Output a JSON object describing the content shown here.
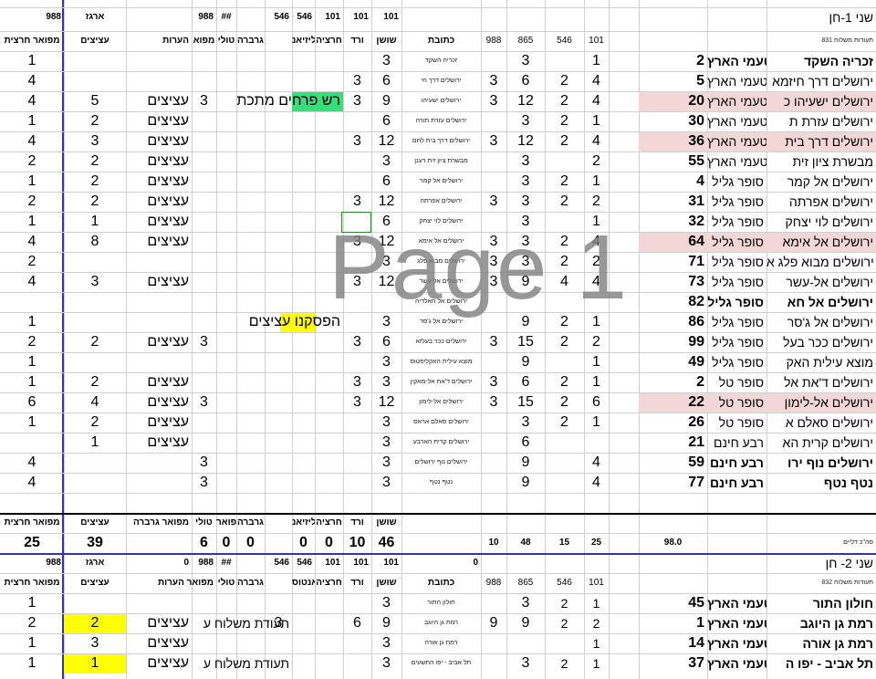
{
  "watermark": "Page 1",
  "section1": {
    "header_row1": {
      "c_988": "988",
      "c_argaz": "ארגז",
      "c_988b": "988",
      "c_hash": "##",
      "c_546a": "546",
      "c_546b": "546",
      "c_101a": "101",
      "c_101b": "101",
      "c_101c": "101"
    },
    "header_row2": {
      "mifoar": "מפואר חרצית",
      "atzitzim": "עציצים",
      "heorot": "הערות",
      "mefoar_t": "מפוא",
      "tulip": "טולי",
      "gerbera": "גרברה",
      "lisianthus": "ליזיאנ",
      "hartzit": "חרציה",
      "vered": "ורד",
      "shoshan": "שושן",
      "ktovet": "כתובת",
      "n988": "988",
      "n865": "865",
      "n546": "546",
      "n101": "101",
      "teudat": "תעודות משלוח 831"
    },
    "title": "שני 1-חן",
    "rows": [
      {
        "mifoar": "1",
        "atzitzim": "",
        "heorot": "",
        "mefoar": "",
        "shoshan": "3",
        "vered": "",
        "hartzit": "",
        "lisianthus": "",
        "ktovet": "זכריה השקד",
        "n988": "",
        "n865": "3",
        "n546": "",
        "n101": "1",
        "num": "2",
        "store": "מטעמי הארץ",
        "city": "זכריה השקד",
        "pink": false,
        "boldname": true
      },
      {
        "mifoar": "4",
        "atzitzim": "",
        "heorot": "",
        "mefoar": "",
        "shoshan": "6",
        "vered": "3",
        "hartzit": "",
        "lisianthus": "",
        "ktovet": "ירושלים דרך חי",
        "n988": "3",
        "n865": "6",
        "n546": "2",
        "n101": "4",
        "num": "5",
        "store": "מטעמי הארץ",
        "city": "ירושלים דרך חיזמא",
        "pink": false,
        "boldname": false
      },
      {
        "mifoar": "4",
        "atzitzim": "5",
        "heorot": "עציצים",
        "mefoar": "3",
        "shoshan": "9",
        "vered": "3",
        "hartzit": "",
        "lisianthus": "רש פרחים מתכת",
        "ktovet": "ירושלים ישעיהו",
        "n988": "3",
        "n865": "12",
        "n546": "2",
        "n101": "4",
        "num": "20",
        "store": "מטעמי הארץ",
        "city": "ירושלים ישעיהו כ",
        "pink": true,
        "boldname": false
      },
      {
        "mifoar": "1",
        "atzitzim": "2",
        "heorot": "עציצים",
        "mefoar": "",
        "shoshan": "6",
        "vered": "",
        "hartzit": "",
        "lisianthus": "",
        "ktovet": "ירושלים עזרת תורה",
        "n988": "",
        "n865": "3",
        "n546": "2",
        "n101": "1",
        "num": "30",
        "store": "מטעמי הארץ",
        "city": "ירושלים עזרת ת",
        "pink": false,
        "boldname": false
      },
      {
        "mifoar": "4",
        "atzitzim": "3",
        "heorot": "עציצים",
        "mefoar": "",
        "shoshan": "12",
        "vered": "3",
        "hartzit": "",
        "lisianthus": "",
        "ktovet": "ירושלים דרך בית לחם",
        "n988": "3",
        "n865": "12",
        "n546": "2",
        "n101": "4",
        "num": "36",
        "store": "מטעמי הארץ",
        "city": "ירושלים דרך בית",
        "pink": true,
        "boldname": false
      },
      {
        "mifoar": "2",
        "atzitzim": "2",
        "heorot": "עציצים",
        "mefoar": "",
        "shoshan": "3",
        "vered": "",
        "hartzit": "",
        "lisianthus": "",
        "ktovet": "מבשרת ציון זית רענן",
        "n988": "",
        "n865": "3",
        "n546": "",
        "n101": "2",
        "num": "55",
        "store": "מטעמי הארץ",
        "city": "מבשרת ציון זית",
        "pink": false,
        "boldname": false
      },
      {
        "mifoar": "1",
        "atzitzim": "2",
        "heorot": "עציצים",
        "mefoar": "",
        "shoshan": "6",
        "vered": "",
        "hartzit": "",
        "lisianthus": "",
        "ktovet": "ירושלים אל קמר",
        "n988": "",
        "n865": "3",
        "n546": "2",
        "n101": "1",
        "num": "4",
        "store": "סופר גליל",
        "city": "ירושלים אל קמר",
        "pink": false,
        "boldname": false
      },
      {
        "mifoar": "2",
        "atzitzim": "2",
        "heorot": "עציצים",
        "mefoar": "",
        "shoshan": "12",
        "vered": "3",
        "hartzit": "",
        "lisianthus": "",
        "ktovet": "ירושלים אפרתה",
        "n988": "3",
        "n865": "3",
        "n546": "2",
        "n101": "2",
        "num": "31",
        "store": "סופר גליל",
        "city": "ירושלים אפרתה",
        "pink": false,
        "boldname": false
      },
      {
        "mifoar": "1",
        "atzitzim": "1",
        "heorot": "עציצים",
        "mefoar": "",
        "shoshan": "6",
        "vered": "",
        "hartzit": "",
        "lisianthus": "",
        "ktovet": "ירושלים לוי יצחק",
        "n988": "",
        "n865": "3",
        "n546": "",
        "n101": "1",
        "num": "32",
        "store": "סופר גליל",
        "city": "ירושלים לוי יצחק",
        "pink": false,
        "boldname": false
      },
      {
        "mifoar": "4",
        "atzitzim": "8",
        "heorot": "עציצים",
        "mefoar": "",
        "shoshan": "12",
        "vered": "3",
        "hartzit": "",
        "lisianthus": "",
        "ktovet": "ירושלים אל אימא",
        "n988": "3",
        "n865": "3",
        "n546": "2",
        "n101": "4",
        "num": "64",
        "store": "סופר גליל",
        "city": "ירושלים אל אימא",
        "pink": true,
        "boldname": false
      },
      {
        "mifoar": "2",
        "atzitzim": "",
        "heorot": "",
        "mefoar": "",
        "shoshan": "3",
        "vered": "",
        "hartzit": "",
        "lisianthus": "",
        "ktovet": "ירושלים מבוא פלג",
        "n988": "3",
        "n865": "3",
        "n546": "2",
        "n101": "2",
        "num": "71",
        "store": "סופר גליל",
        "city": "ירושלים מבוא פלג א",
        "pink": false,
        "boldname": false
      },
      {
        "mifoar": "4",
        "atzitzim": "3",
        "heorot": "עציצים",
        "mefoar": "",
        "shoshan": "12",
        "vered": "3",
        "hartzit": "",
        "lisianthus": "",
        "ktovet": "ירושלים אל-עשר",
        "n988": "3",
        "n865": "9",
        "n546": "4",
        "n101": "4",
        "num": "73",
        "store": "סופר גליל",
        "city": "ירושלים אל-עשר",
        "pink": false,
        "boldname": false
      },
      {
        "mifoar": "",
        "atzitzim": "",
        "heorot": "",
        "mefoar": "",
        "shoshan": "",
        "vered": "",
        "hartzit": "",
        "lisianthus": "",
        "ktovet": "ירושלים אל חאלדיה",
        "n988": "",
        "n865": "",
        "n546": "",
        "n101": "",
        "num": "82",
        "store": "סופר גליל",
        "city": "ירושלים אל חא",
        "pink": false,
        "boldname": true
      },
      {
        "mifoar": "1",
        "atzitzim": "",
        "heorot": "",
        "mefoar": "",
        "shoshan": "3",
        "vered": "",
        "hartzit": "",
        "lisianthus": "הפסקנו עציצים",
        "ktovet": "ירושלים אל ג'סר",
        "n988": "",
        "n865": "9",
        "n546": "2",
        "n101": "1",
        "num": "86",
        "store": "סופר גליל",
        "city": "ירושלים אל ג'סר",
        "pink": false,
        "boldname": false
      },
      {
        "mifoar": "2",
        "atzitzim": "2",
        "heorot": "עציצים",
        "mefoar": "3",
        "shoshan": "6",
        "vered": "3",
        "hartzit": "",
        "lisianthus": "",
        "ktovet": "ירושלים ככר בעלזא",
        "n988": "3",
        "n865": "15",
        "n546": "2",
        "n101": "2",
        "num": "99",
        "store": "סופר גליל",
        "city": "ירושלים ככר בעל",
        "pink": false,
        "boldname": false
      },
      {
        "mifoar": "1",
        "atzitzim": "",
        "heorot": "",
        "mefoar": "",
        "shoshan": "3",
        "vered": "",
        "hartzit": "",
        "lisianthus": "",
        "ktovet": "מוצא עילית האקליפטוס",
        "n988": "",
        "n865": "9",
        "n546": "",
        "n101": "1",
        "num": "49",
        "store": "סופר גליל",
        "city": "מוצא עילית האק",
        "pink": false,
        "boldname": false
      },
      {
        "mifoar": "1",
        "atzitzim": "2",
        "heorot": "עציצים",
        "mefoar": "",
        "shoshan": "3",
        "vered": "3",
        "hartzit": "",
        "lisianthus": "",
        "ktovet": "ירושלים ד'את אל-מאקין",
        "n988": "3",
        "n865": "6",
        "n546": "2",
        "n101": "1",
        "num": "2",
        "store": "סופר טל",
        "city": "ירושלים ד'את אל",
        "pink": false,
        "boldname": false
      },
      {
        "mifoar": "6",
        "atzitzim": "4",
        "heorot": "עציצים",
        "mefoar": "3",
        "shoshan": "12",
        "vered": "3",
        "hartzit": "",
        "lisianthus": "",
        "ktovet": "ירושלים אל-לימון",
        "n988": "3",
        "n865": "15",
        "n546": "2",
        "n101": "6",
        "num": "22",
        "store": "סופר טל",
        "city": "ירושלים אל-לימון",
        "pink": true,
        "boldname": false
      },
      {
        "mifoar": "1",
        "atzitzim": "2",
        "heorot": "עציצים",
        "mefoar": "",
        "shoshan": "3",
        "vered": "",
        "hartzit": "",
        "lisianthus": "",
        "ktovet": "ירושלים סאלם אראס",
        "n988": "",
        "n865": "3",
        "n546": "2",
        "n101": "1",
        "num": "26",
        "store": "סופר טל",
        "city": "ירושלים סאלם א",
        "pink": false,
        "boldname": false
      },
      {
        "mifoar": "",
        "atzitzim": "1",
        "heorot": "עציצים",
        "mefoar": "",
        "shoshan": "3",
        "vered": "",
        "hartzit": "",
        "lisianthus": "",
        "ktovet": "ירושלים קרית הארבע",
        "n988": "",
        "n865": "6",
        "n546": "",
        "n101": "",
        "num": "21",
        "store": "רבע חינם",
        "city": "ירושלים קרית הא",
        "pink": false,
        "boldname": false
      },
      {
        "mifoar": "4",
        "atzitzim": "",
        "heorot": "",
        "mefoar": "3",
        "shoshan": "3",
        "vered": "",
        "hartzit": "",
        "lisianthus": "",
        "ktovet": "ירושלים נוף ירושלים",
        "n988": "",
        "n865": "9",
        "n546": "",
        "n101": "4",
        "num": "59",
        "store": "רבע חינם",
        "city": "ירושלים נוף ירו",
        "pink": false,
        "boldname": true
      },
      {
        "mifoar": "4",
        "atzitzim": "",
        "heorot": "",
        "mefoar": "3",
        "shoshan": "3",
        "vered": "",
        "hartzit": "",
        "lisianthus": "",
        "ktovet": "נטף נטף",
        "n988": "",
        "n865": "9",
        "n546": "",
        "n101": "4",
        "num": "77",
        "store": "רבע חינם",
        "city": "נטף נטף",
        "pink": false,
        "boldname": true
      }
    ],
    "totals_labels": {
      "mifoar": "מפואר חרצית",
      "atzitzim": "עציצים",
      "gerbera_big": "מפואר גרברה",
      "tulip": "טולי",
      "mefoar": "מפואר",
      "gerbera": "גרברה",
      "lisianthus": "ליזיאנ",
      "hartzit": "חרציה",
      "vered": "ורד",
      "shoshan": "שושן"
    },
    "totals": {
      "mifoar": "25",
      "atzitzim": "39",
      "mefoar": "6",
      "tulip": "0",
      "gerbera": "0",
      "lisianthus": "0",
      "hartzit": "0",
      "vered": "10",
      "shoshan": "46",
      "n988": "10",
      "n865": "48",
      "n546": "15",
      "n101": "25",
      "num": "98.0",
      "label": "סה\"כ דליים"
    }
  },
  "section2": {
    "header_row1": {
      "c_988": "988",
      "c_argaz": "ארגז",
      "c_zero": "0",
      "c_988b": "988",
      "c_hash": "##",
      "c_546a": "546",
      "c_546b": "546",
      "c_101a": "101",
      "c_101b": "101",
      "c_101c": "101",
      "c_zero2": "0"
    },
    "header_row2": {
      "mifoar": "מפואר חרצית",
      "atzitzim": "עציצים",
      "heorot": "מפואר הערות",
      "tulip": "טולי",
      "gerbera": "גרברה",
      "lisianthus": "ליזיאנטוס",
      "hartzit": "חרציה",
      "vered": "ורד",
      "shoshan": "שושן",
      "ktovet": "כתובת",
      "n988": "988",
      "n865": "865",
      "n546": "546",
      "n101": "101",
      "teudat": "תעודות משלוח 832"
    },
    "title": "שני 2- חן",
    "rows": [
      {
        "mifoar": "1",
        "atzitzim": "",
        "yellow": false,
        "heorot": "",
        "note": "",
        "tulip": "",
        "gerbera": "",
        "vered": "",
        "shoshan": "3",
        "ktovet": "חולון התור",
        "n988": "",
        "n865": "3",
        "n546": "2",
        "n101": "1",
        "num": "45",
        "store": "מטעמי הארץ",
        "city": "חולון התור"
      },
      {
        "mifoar": "2",
        "atzitzim": "2",
        "yellow": true,
        "heorot": "עציצים",
        "note": "תעודת משלוח ע",
        "tulip": "",
        "gerbera": "3",
        "vered": "6",
        "shoshan": "9",
        "ktovet": "רמת גן היוגב",
        "n988": "9",
        "n865": "9",
        "n546": "2",
        "n101": "2",
        "num": "1",
        "store": "מטעמי הארץ",
        "city": "רמת גן היוגב"
      },
      {
        "mifoar": "1",
        "atzitzim": "3",
        "yellow": false,
        "heorot": "עציצים",
        "note": "",
        "tulip": "",
        "gerbera": "",
        "vered": "",
        "shoshan": "3",
        "ktovet": "רמת גן אורה",
        "n988": "",
        "n865": "",
        "n546": "",
        "n101": "1",
        "num": "14",
        "store": "מטעמי הארץ",
        "city": "רמת גן אורה"
      },
      {
        "mifoar": "1",
        "atzitzim": "1",
        "yellow": true,
        "heorot": "עציצים",
        "note": "תעודת משלוח ע",
        "tulip": "",
        "gerbera": "",
        "vered": "",
        "shoshan": "3",
        "ktovet": "תל אביב - יפו התשעים",
        "n988": "",
        "n865": "3",
        "n546": "2",
        "n101": "1",
        "num": "37",
        "store": "מטעמי הארץ",
        "city": "תל אביב - יפו ה"
      }
    ]
  }
}
